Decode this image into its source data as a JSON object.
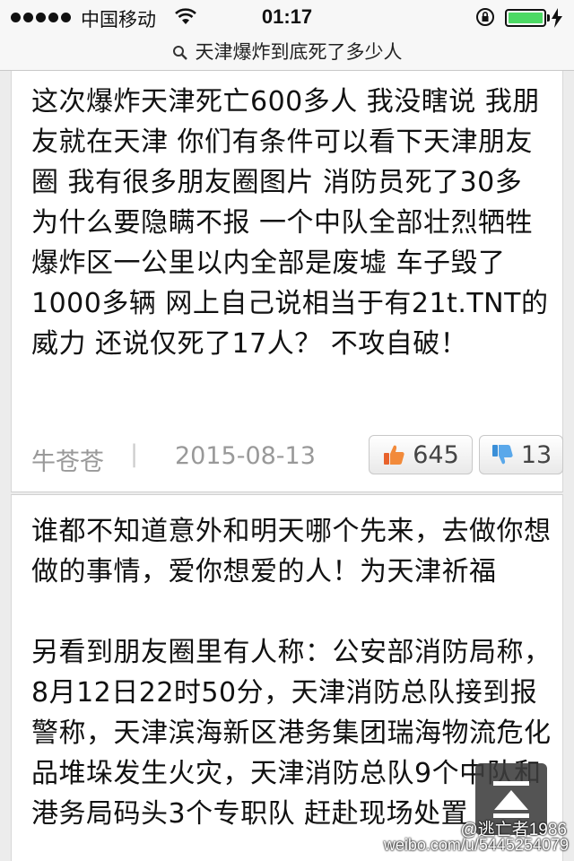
{
  "status_bar": {
    "carrier": "中国移动",
    "time": "01:17"
  },
  "search": {
    "query": "天津爆炸到底死了多少人"
  },
  "comments": [
    {
      "text": "这次爆炸天津死亡600多人 我没瞎说 我朋友就在天津 你们有条件可以看下天津朋友圈 我有很多朋友圈图片 消防员死了30多 为什么要隐瞒不报 一个中队全部壮烈牺牲 爆炸区一公里以内全部是废墟 车子毁了1000多辆 网上自己说相当于有21t.TNT的威力 还说仅死了17人？ 不攻自破！",
      "author": "牛苍苍",
      "separator": "|",
      "date": "2015-08-13",
      "likes": "645",
      "dislikes": "13"
    },
    {
      "text": "谁都不知道意外和明天哪个先来，去做你想做的事情，爱你想爱的人！为天津祈福",
      "text2": "另看到朋友圈里有人称：公安部消防局称，8月12日22时50分，天津消防总队接到报警称，天津滨海新区港务集团瑞海物流危化品堆垛发生火灾，天津消防总队9个中队和港务局码头3个专职队 赶赴现场处置"
    }
  ],
  "watermark": {
    "user": "@逃亡者1986",
    "url": "weibo.com/u/5445254079"
  },
  "colors": {
    "battery": "#4cd964",
    "thumb_up": "#e8622c",
    "thumb_down": "#3a8fd8"
  },
  "icons": [
    "signal-dots-icon",
    "wifi-icon",
    "rotation-lock-icon",
    "battery-icon",
    "charging-icon",
    "search-icon",
    "thumb-up-icon",
    "thumb-down-icon",
    "scroll-top-icon"
  ]
}
